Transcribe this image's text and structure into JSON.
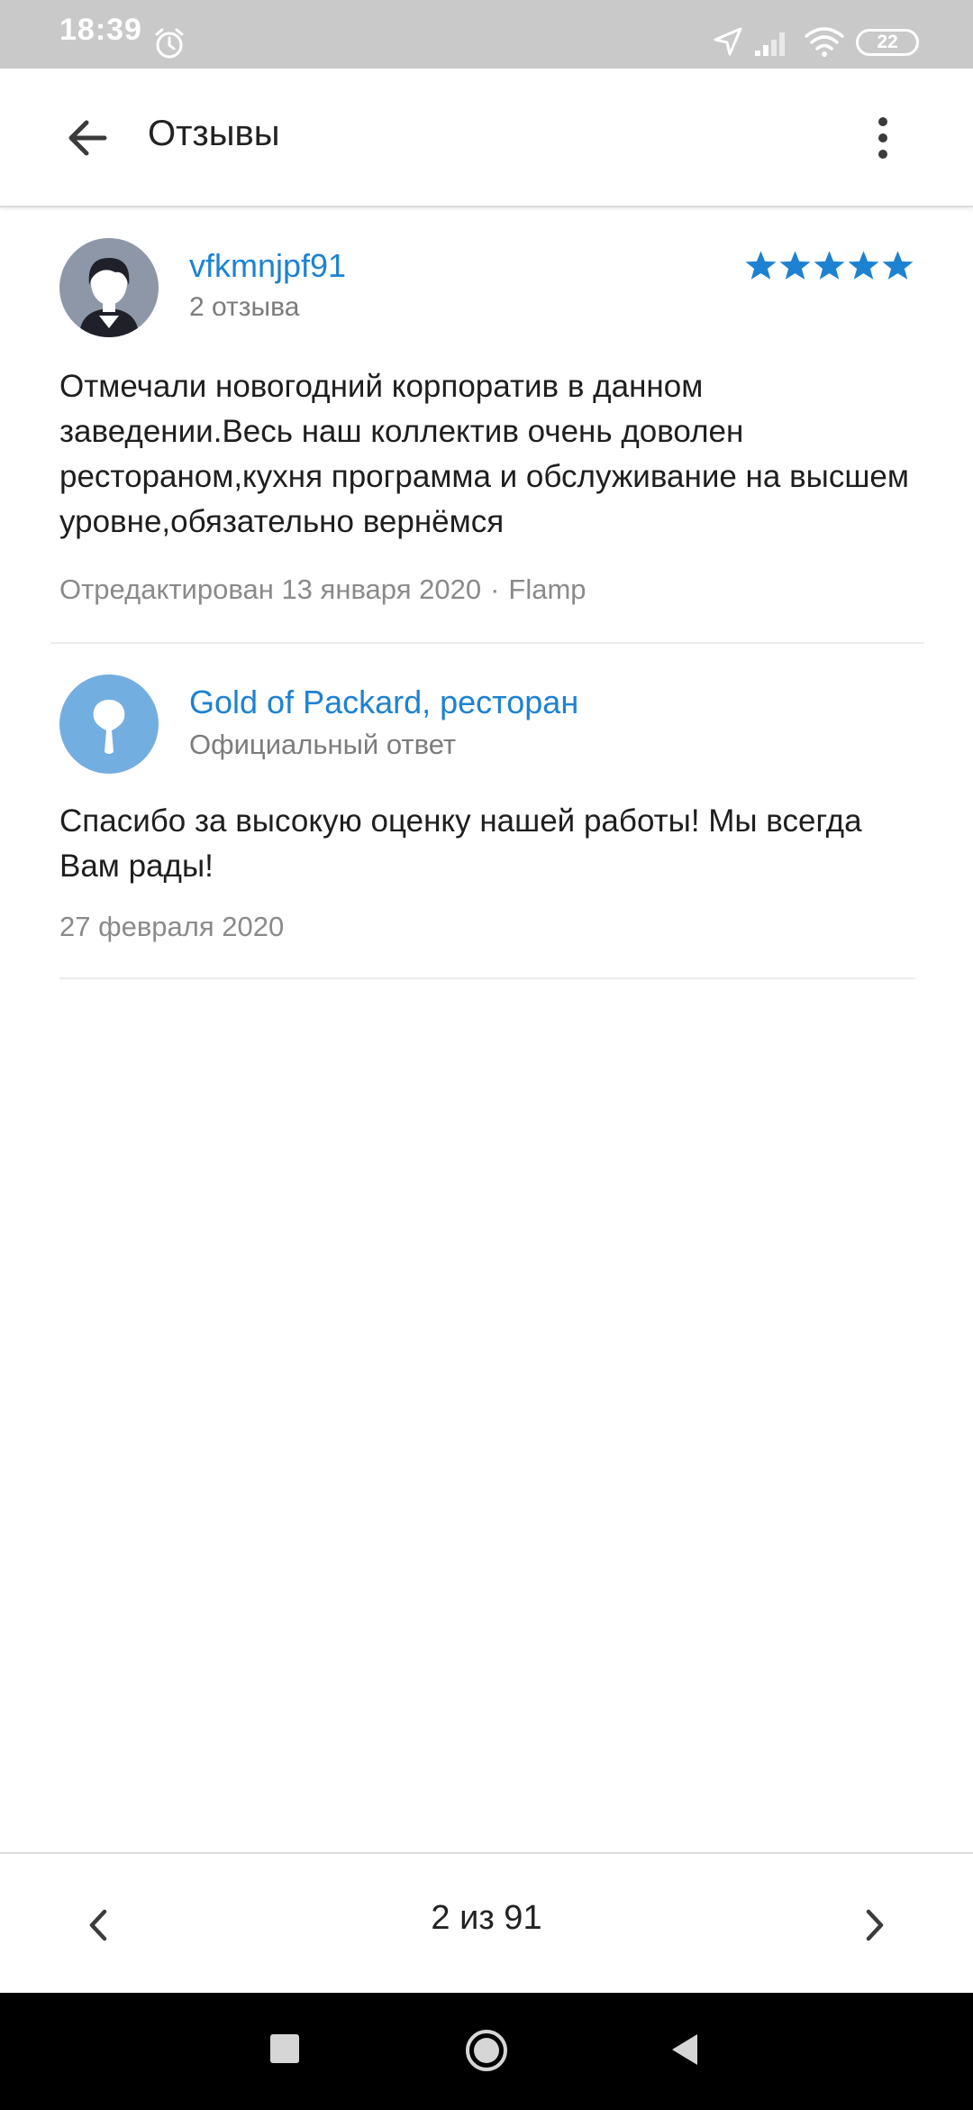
{
  "status_bar": {
    "time": "18:39",
    "battery": "22"
  },
  "app_bar": {
    "title": "Отзывы"
  },
  "review": {
    "author": "vfkmnjpf91",
    "author_reviews": "2 отзыва",
    "rating": 5,
    "text": "Отмечали новогодний корпоратив в данном заведении.Весь наш коллектив очень доволен рестораном,кухня программа и обслуживание на высшем уровне,обязательно вернёмся",
    "edited": "Отредактирован 13 января 2020",
    "separator": "·",
    "source": "Flamp"
  },
  "reply": {
    "org_name": "Gold of Packard, ресторан",
    "org_label": "Официальный ответ",
    "text": "Спасибо за высокую оценку нашей работы! Мы всегда Вам рады!",
    "date": "27 февраля 2020"
  },
  "pager": {
    "label": "2 из 91"
  },
  "colors": {
    "accent": "#1d82d1",
    "star": "#1d82d1",
    "status_bar_bg": "#c9c9c9",
    "nav_bar_bg": "#000000"
  },
  "icons": {
    "back": "arrow-left-icon",
    "menu": "more-vertical-icon",
    "prev": "chevron-left-icon",
    "next": "chevron-right-icon"
  }
}
